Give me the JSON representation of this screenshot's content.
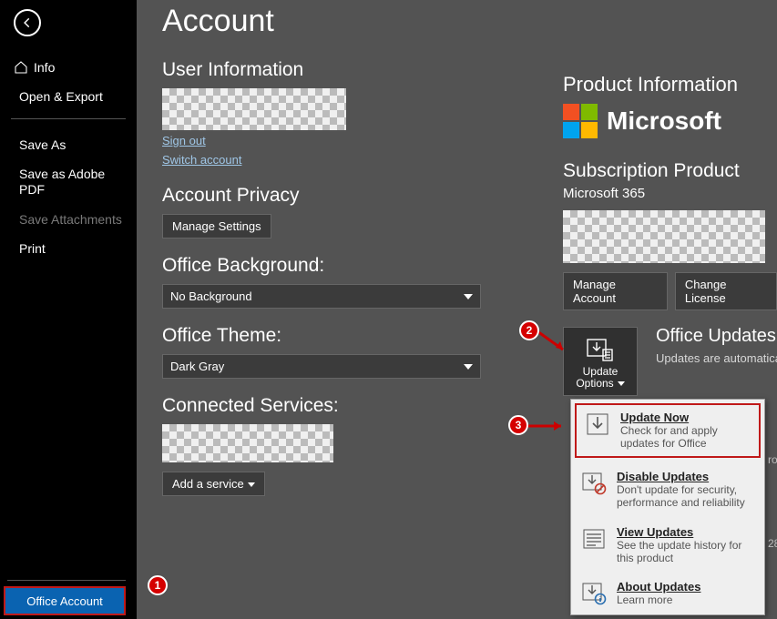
{
  "page_title": "Account",
  "sidebar": {
    "info": "Info",
    "open_export": "Open & Export",
    "save_as": "Save As",
    "save_adobe": "Save as Adobe PDF",
    "save_attachments": "Save Attachments",
    "print": "Print",
    "office_account": "Office Account"
  },
  "left": {
    "user_info_h": "User Information",
    "sign_out": "Sign out",
    "switch_account": "Switch account",
    "privacy_h": "Account Privacy",
    "manage_settings": "Manage Settings",
    "bg_h": "Office Background:",
    "bg_value": "No Background",
    "theme_h": "Office Theme:",
    "theme_value": "Dark Gray",
    "services_h": "Connected Services:",
    "add_service": "Add a service"
  },
  "right": {
    "prod_info_h": "Product Information",
    "ms_word": "Microsoft",
    "sub_h": "Subscription Product",
    "sub_name": "Microsoft 365",
    "manage_account": "Manage Account",
    "change_license": "Change License",
    "update_options": "Update Options",
    "updates_h": "Office Updates",
    "updates_sub": "Updates are automatically"
  },
  "menu": {
    "update_now_t": "Update Now",
    "update_now_d": "Check for and apply updates for Office",
    "disable_t": "Disable Updates",
    "disable_d": "Don't update for security, performance and reliability",
    "view_t": "View Updates",
    "view_d": "See the update history for this product",
    "about_t": "About Updates",
    "about_d": "Learn more"
  },
  "annotations": {
    "b1": "1",
    "b2": "2",
    "b3": "3"
  },
  "cut": {
    "ro": "ro",
    "v28": "28."
  },
  "colors": {
    "ms_red": "#f25022",
    "ms_green": "#7fba00",
    "ms_blue": "#00a4ef",
    "ms_yellow": "#ffb900"
  }
}
